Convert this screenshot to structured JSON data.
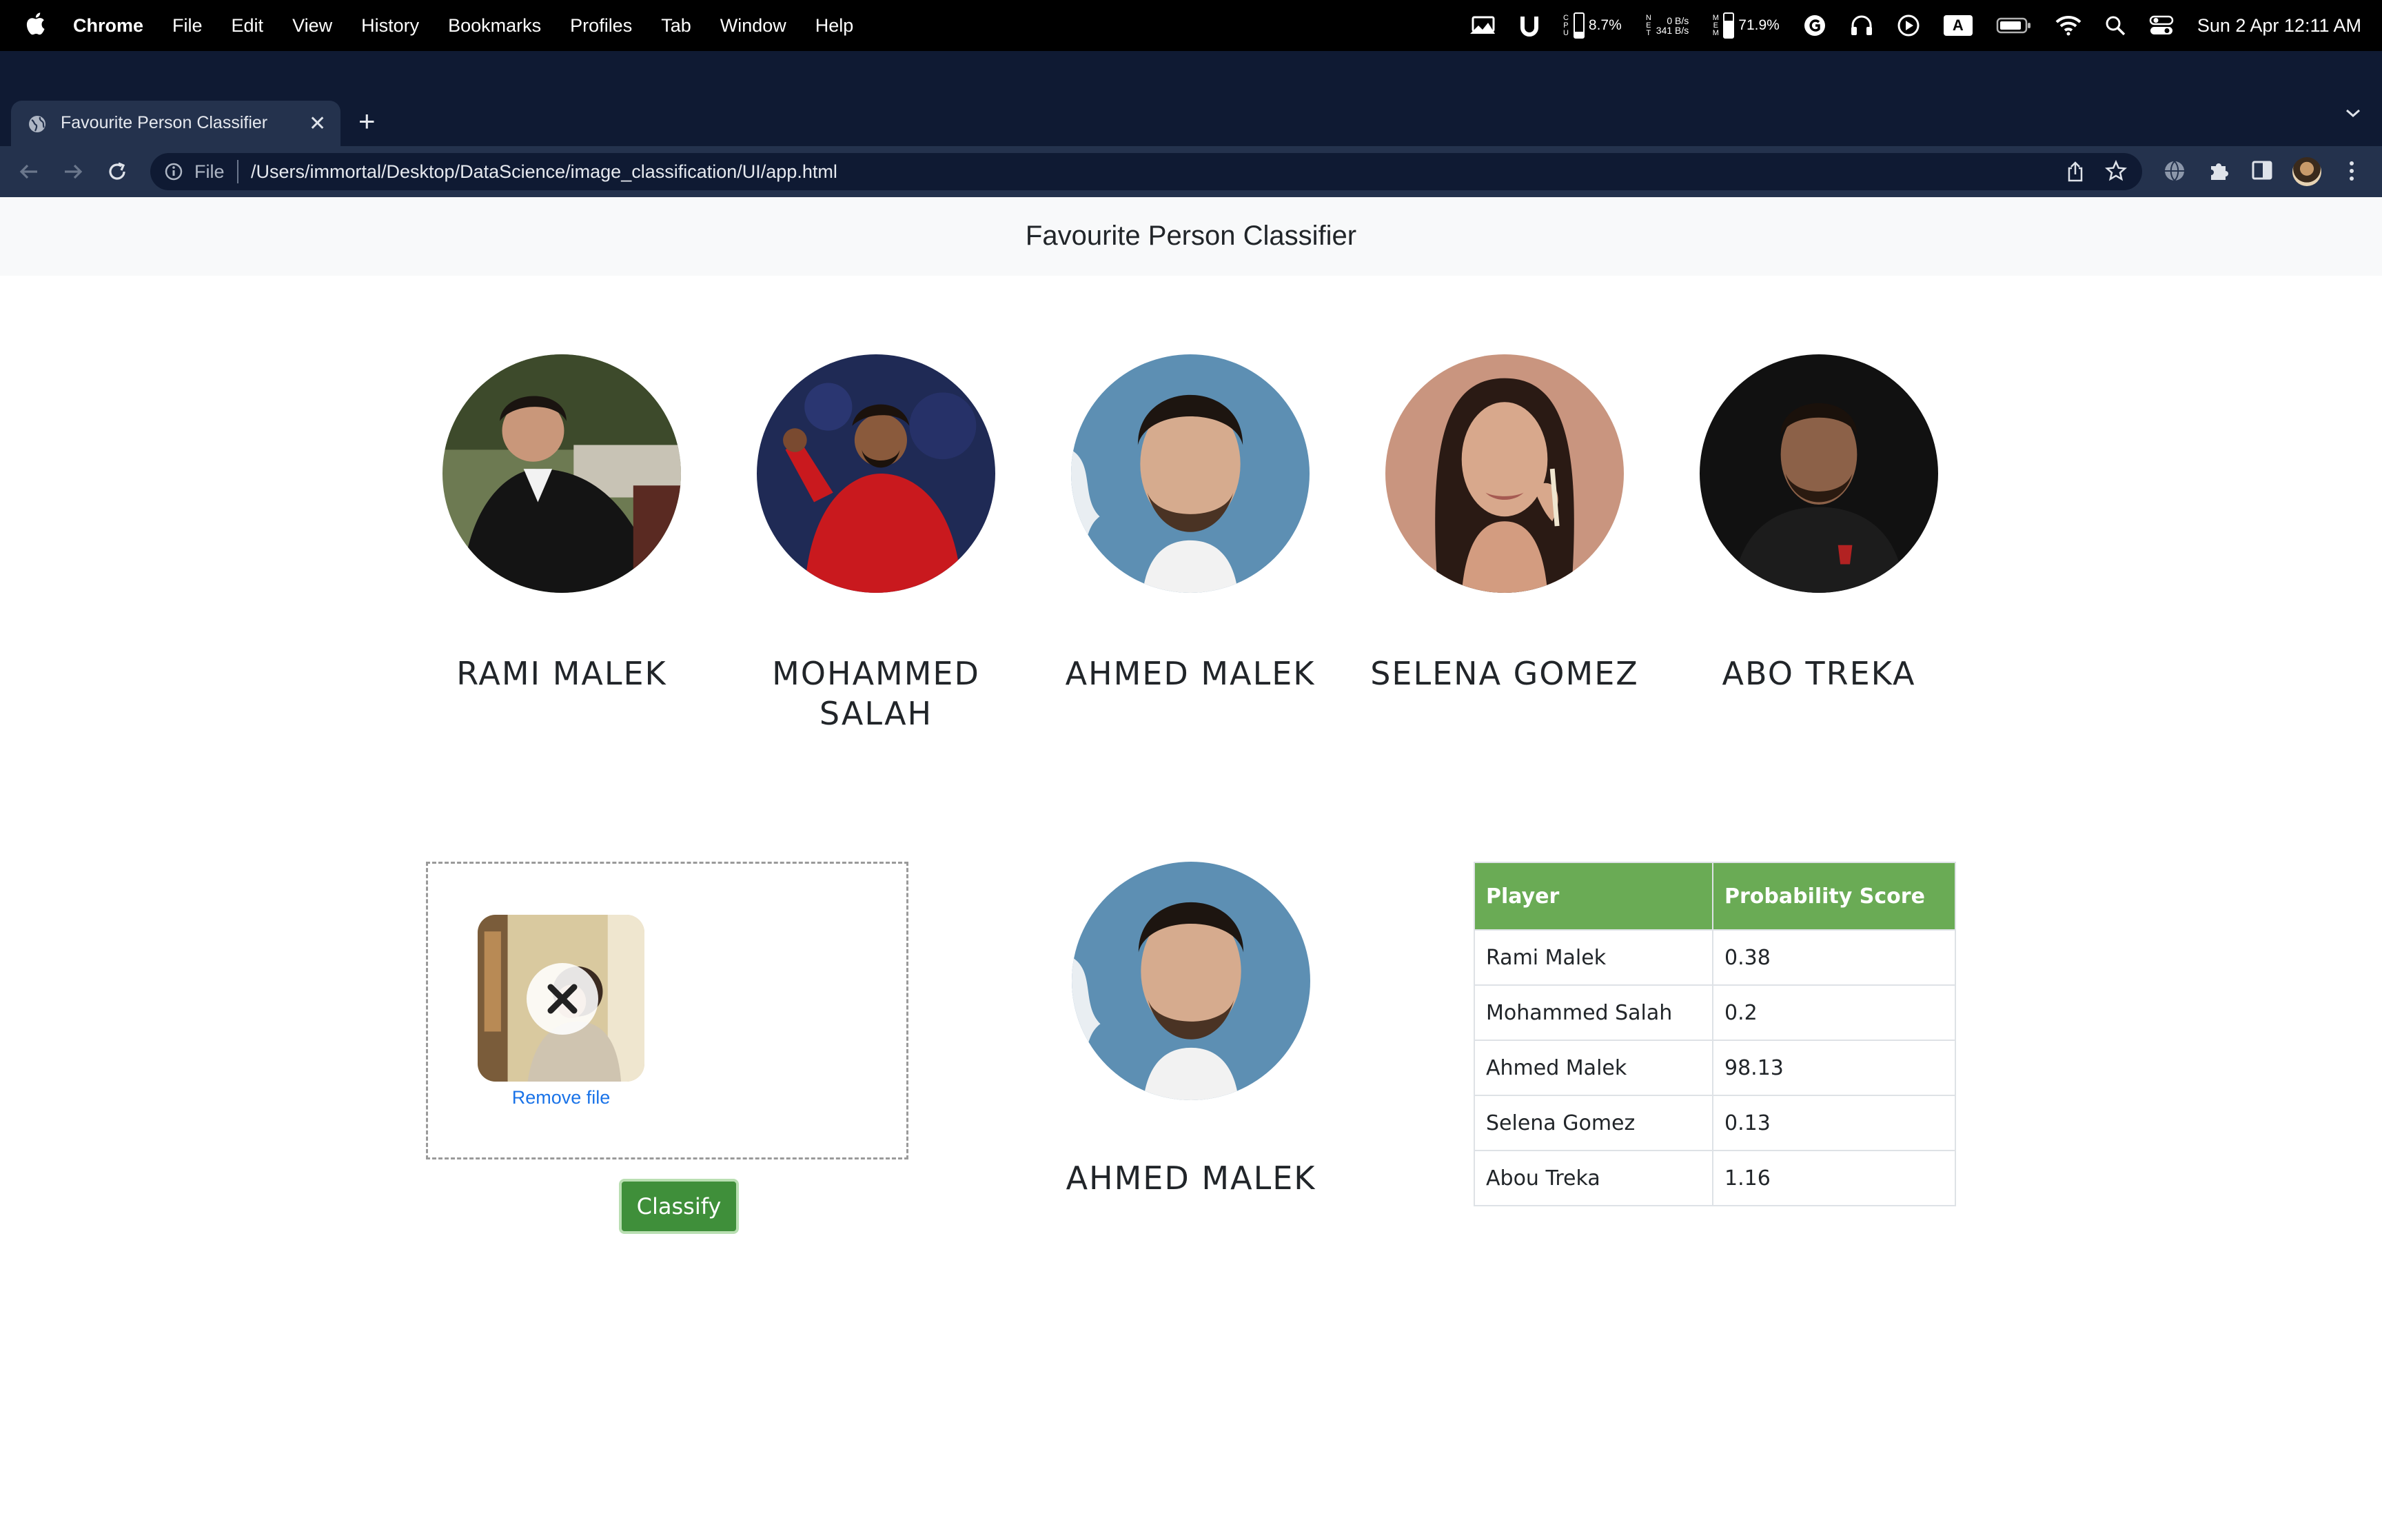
{
  "menubar": {
    "app_name": "Chrome",
    "menus": [
      "File",
      "Edit",
      "View",
      "History",
      "Bookmarks",
      "Profiles",
      "Tab",
      "Window",
      "Help"
    ],
    "cpu_percent": "8.7%",
    "net_down": "0 B/s",
    "net_up": "341 B/s",
    "mem_percent": "71.9%",
    "input_source": "A",
    "clock": "Sun 2 Apr  12:11 AM",
    "cpu_level": 0.25,
    "mem_level": 0.72
  },
  "browser": {
    "tab_title": "Favourite Person Classifier",
    "scheme_label": "File",
    "url": "/Users/immortal/Desktop/DataScience/image_classification/UI/app.html"
  },
  "page": {
    "brand": "Favourite Person Classifier",
    "people": [
      {
        "name": "RAMI MALEK",
        "icon": "photo-rami-malek"
      },
      {
        "name": "MOHAMMED SALAH",
        "icon": "photo-mohammed-salah"
      },
      {
        "name": "AHMED MALEK",
        "icon": "photo-ahmed-malek"
      },
      {
        "name": "SELENA GOMEZ",
        "icon": "photo-selena-gomez"
      },
      {
        "name": "ABO TREKA",
        "icon": "photo-abo-treka"
      }
    ],
    "upload": {
      "remove_label": "Remove file"
    },
    "classify_label": "Classify",
    "result_name": "AHMED MALEK",
    "table": {
      "headers": [
        "Player",
        "Probability Score"
      ],
      "rows": [
        {
          "player": "Rami Malek",
          "score": "0.38"
        },
        {
          "player": "Mohammed Salah",
          "score": "0.2"
        },
        {
          "player": "Ahmed Malek",
          "score": "98.13"
        },
        {
          "player": "Selena Gomez",
          "score": "0.13"
        },
        {
          "player": "Abou Treka",
          "score": "1.16"
        }
      ]
    },
    "colors": {
      "header_green": "#6aab55",
      "button_green": "#3f8f3a",
      "link_blue": "#1a73e8"
    }
  }
}
